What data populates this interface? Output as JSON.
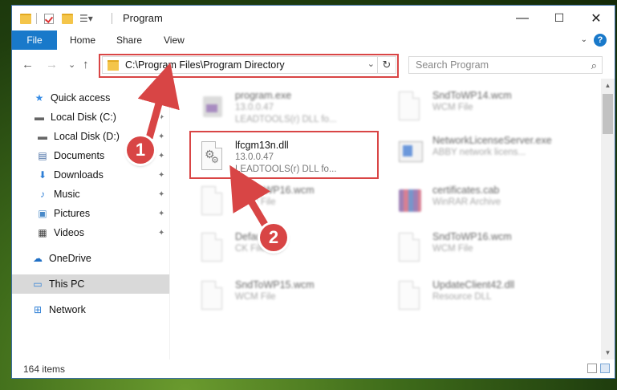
{
  "window": {
    "title": "Program",
    "controls": {
      "minimize": "—",
      "maximize": "☐",
      "close": "✕"
    }
  },
  "ribbon": {
    "tabs": [
      "File",
      "Home",
      "Share",
      "View"
    ],
    "help": "?",
    "expand": "⌄"
  },
  "nav": {
    "back": "←",
    "forward": "→",
    "recent": "⌄",
    "up": "↑",
    "address": "C:\\Program Files\\Program Directory",
    "address_dropdown": "⌄",
    "refresh": "↻",
    "search_placeholder": "Search Program",
    "search_icon": "⌕"
  },
  "sidebar": {
    "items": [
      {
        "label": "Quick access",
        "icon": "star-icon",
        "glyph": "★",
        "color": "#3a8ee6",
        "pinned": false
      },
      {
        "label": "Local Disk (C:)",
        "icon": "drive-icon",
        "glyph": "▬",
        "color": "#666666",
        "pinned": true
      },
      {
        "label": "Local Disk (D:)",
        "icon": "drive-icon",
        "glyph": "▬",
        "color": "#666666",
        "pinned": true
      },
      {
        "label": "Documents",
        "icon": "documents-icon",
        "glyph": "▤",
        "color": "#4a6fa5",
        "pinned": true
      },
      {
        "label": "Downloads",
        "icon": "downloads-icon",
        "glyph": "⬇",
        "color": "#2f7fd6",
        "pinned": true
      },
      {
        "label": "Music",
        "icon": "music-icon",
        "glyph": "♪",
        "color": "#2f7fd6",
        "pinned": true
      },
      {
        "label": "Pictures",
        "icon": "pictures-icon",
        "glyph": "▣",
        "color": "#4a8ac9",
        "pinned": true
      },
      {
        "label": "Videos",
        "icon": "videos-icon",
        "glyph": "▦",
        "color": "#444444",
        "pinned": true
      },
      {
        "label": "OneDrive",
        "icon": "cloud-icon",
        "glyph": "☁",
        "color": "#1f6fc5",
        "pinned": false
      },
      {
        "label": "This PC",
        "icon": "computer-icon",
        "glyph": "▭",
        "color": "#2f7fd6",
        "pinned": false,
        "selected": true
      },
      {
        "label": "Network",
        "icon": "network-icon",
        "glyph": "⊞",
        "color": "#2f7fd6",
        "pinned": false
      }
    ],
    "pin_glyph": "📌"
  },
  "files": [
    {
      "name": "program.exe",
      "line1": "13.0.0.47",
      "line2": "LEADTOOLS(r) DLL fo...",
      "icon": "exe-icon",
      "blurred": true
    },
    {
      "name": "SndToWP14.wcm",
      "line1": "WCM File",
      "line2": "",
      "icon": "document-icon",
      "blurred": true
    },
    {
      "name": "lfcgm13n.dll",
      "line1": "13.0.0.47",
      "line2": "LEADTOOLS(r) DLL fo...",
      "icon": "dll-gear-icon",
      "blurred": false
    },
    {
      "name": "NetworkLicenseServer.exe",
      "line1": "ABBY network licens...",
      "line2": "",
      "icon": "exe-window-icon",
      "blurred": true
    },
    {
      "name": "SndToWP16.wcm",
      "line1": "WCM File",
      "line2": "",
      "icon": "document-icon",
      "blurred": true
    },
    {
      "name": "certificates.cab",
      "line1": "WinRAR Archive",
      "line2": "",
      "icon": "archive-icon",
      "blurred": true
    },
    {
      "name": "Default.lnk",
      "line1": "CK File",
      "line2": "",
      "icon": "document-icon",
      "blurred": true
    },
    {
      "name": "SndToWP16.wcm",
      "line1": "WCM File",
      "line2": "",
      "icon": "document-icon",
      "blurred": true
    },
    {
      "name": "SndToWP15.wcm",
      "line1": "WCM File",
      "line2": "",
      "icon": "document-icon",
      "blurred": true
    },
    {
      "name": "UpdateClient42.dll",
      "line1": "Resource DLL",
      "line2": "",
      "icon": "document-icon",
      "blurred": true
    }
  ],
  "status": {
    "count": "164 items"
  },
  "callouts": {
    "first": "1",
    "second": "2"
  },
  "colors": {
    "accent": "#1979ca",
    "highlight": "#d94545",
    "selection": "#d9d9d9"
  }
}
